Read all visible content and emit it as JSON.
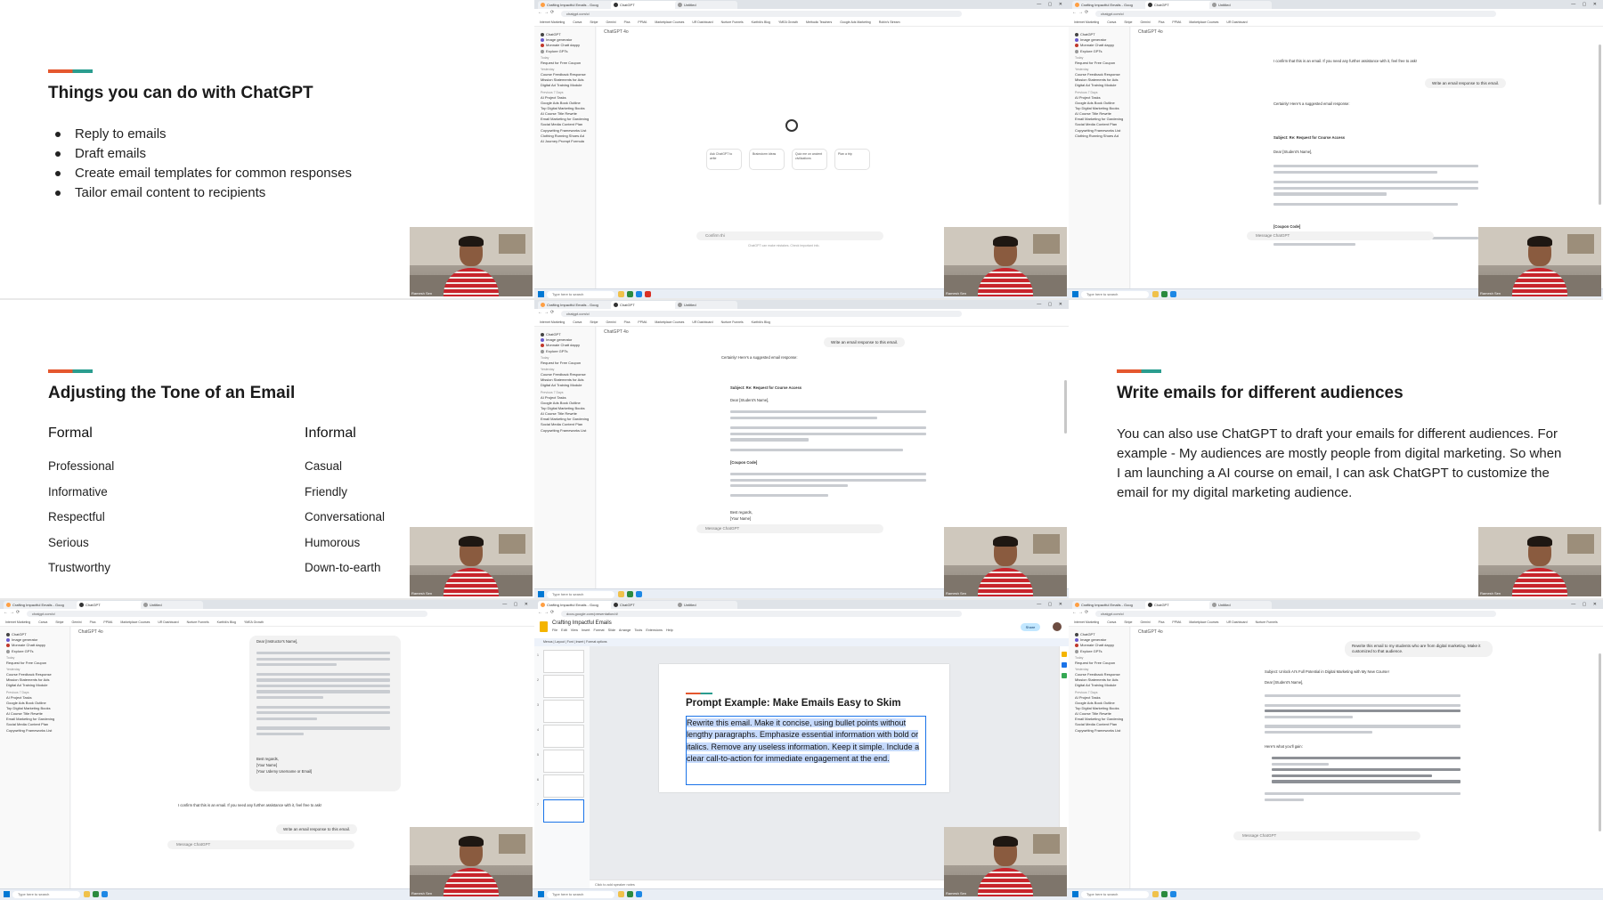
{
  "slide1": {
    "title": "Things you can do with ChatGPT",
    "bullets": [
      "Reply to emails",
      "Draft emails",
      "Create email templates for common responses",
      "Tailor email content to recipients"
    ]
  },
  "slide2": {
    "title": "Adjusting the Tone of an Email",
    "formal_header": "Formal",
    "formal": [
      "Professional",
      "Informative",
      "Respectful",
      "Serious",
      "Trustworthy"
    ],
    "informal_header": "Informal",
    "informal": [
      "Casual",
      "Friendly",
      "Conversational",
      "Humorous",
      "Down-to-earth"
    ]
  },
  "slide3": {
    "title": "Write emails for different audiences",
    "body": "You can also use ChatGPT to draft your emails for different audiences. For example - My audiences are mostly people from digital marketing. So when I am launching a AI course on email, I can ask ChatGPT to customize the email for my digital marketing audience."
  },
  "chatgpt": {
    "model": "ChatGPT 4o",
    "sidebar_top": [
      "ChatGPT",
      "Image generator",
      "Monnaie Chatt dappy",
      "Explore GPTs"
    ],
    "section_today": "Today",
    "today": [
      "Request for Free Coupon"
    ],
    "section_yesterday": "Yesterday",
    "yesterday": [
      "Course Feedback Response",
      "Mission Statements for Ads",
      "Digital Ad Training Module"
    ],
    "section_prev": "Previous 7 Days",
    "previous": [
      "AI Project Tasks",
      "Google Ads Book Outline",
      "Top Digital Marketing Books",
      "AI Course Title Rewrite",
      "Email Marketing for Gardening",
      "Social Media Content Plan",
      "Copywriting Frameworks List",
      "Clothing Running Shoes Ad",
      "AI Journey Prompt Formula"
    ],
    "message_placeholder": "Message ChatGPT",
    "typed_message": "Confirm thi",
    "footnote": "ChatGPT can make mistakes. Check important info.",
    "user_msg_reply": "Write an email response to this email.",
    "assistant_intro": "Certainly! Here's a suggested email response:",
    "email_subject": "Subject: Re: Request for Course Access",
    "email_greeting": "Dear [Student's Name],",
    "email_code": "[Coupon Code]",
    "email_close": "Best regards,",
    "email_sign": "[Your Name]",
    "confirm_text": "I confirm that this is an email. If you need any further assistance with it, feel free to ask!",
    "instructor_greeting": "Dear [Instructor's Name],",
    "instructor_regards": "Best regards,",
    "instructor_sign1": "[Your Name]",
    "instructor_sign2": "[Your Udemy Username or Email]",
    "audience_prompt": "Rewrite this email to my students who are from digital marketing. Make it customized to that audience.",
    "audience_subject": "Subject: Unlock AI's Full Potential in Digital Marketing with My New Course!",
    "audience_greeting": "Dear [Student's Name],",
    "audience_list": "Here's what you'll gain:",
    "cards": [
      "Ask ChatGPT to write",
      "Brainstorm ideas",
      "Quiz me on ancient civilizations",
      "Plan a trip"
    ]
  },
  "browser": {
    "tab1": "Crafting Impactful Emails - Goog",
    "tab2": "ChatGPT",
    "tab3": "Untitled",
    "url_chatgpt": "chatgpt.com/c/",
    "url_docs": "docs.google.com/presentation/d/",
    "bookmarks": [
      "Internet Marketing",
      "Canva",
      "Stripe",
      "Gemini",
      "Pixa",
      "PPMA",
      "Marketplace Courses",
      "UR Dashboard",
      "Nurture Funnels",
      "Karthik's Blog",
      "YMEA Growth",
      "Methodic Teachers",
      "Google Ads Marketing",
      "Robin's Stream"
    ],
    "taskbar_search": "Type here to search"
  },
  "docs": {
    "title": "Crafting Impactful Emails",
    "menu": "File  Edit  View  Insert  Format  Slide  Arrange  Tools  Extensions  Help",
    "toolbar": "Menus  |  Layout  |  Font  |  Insert  |  Format options",
    "share_label": "Share",
    "slide_title": "Prompt Example: Make Emails Easy to Skim",
    "slide_body": "Rewrite this email. Make it concise, using bullet points without lengthy paragraphs. Emphasize essential information with bold or italics. Remove any useless information. Keep it simple. Include a clear call-to-action for immediate engagement at the end.",
    "notes": "Click to add speaker notes",
    "thumb_numbers": [
      "1",
      "2",
      "3",
      "4",
      "5",
      "6",
      "7"
    ]
  },
  "webcam": {
    "name": "Ramesh Sen"
  },
  "colors": {
    "accent_red": "#e4572e",
    "accent_teal": "#2a9d8f",
    "docs_blue": "#1a73e8",
    "selection": "#c6dafc"
  }
}
